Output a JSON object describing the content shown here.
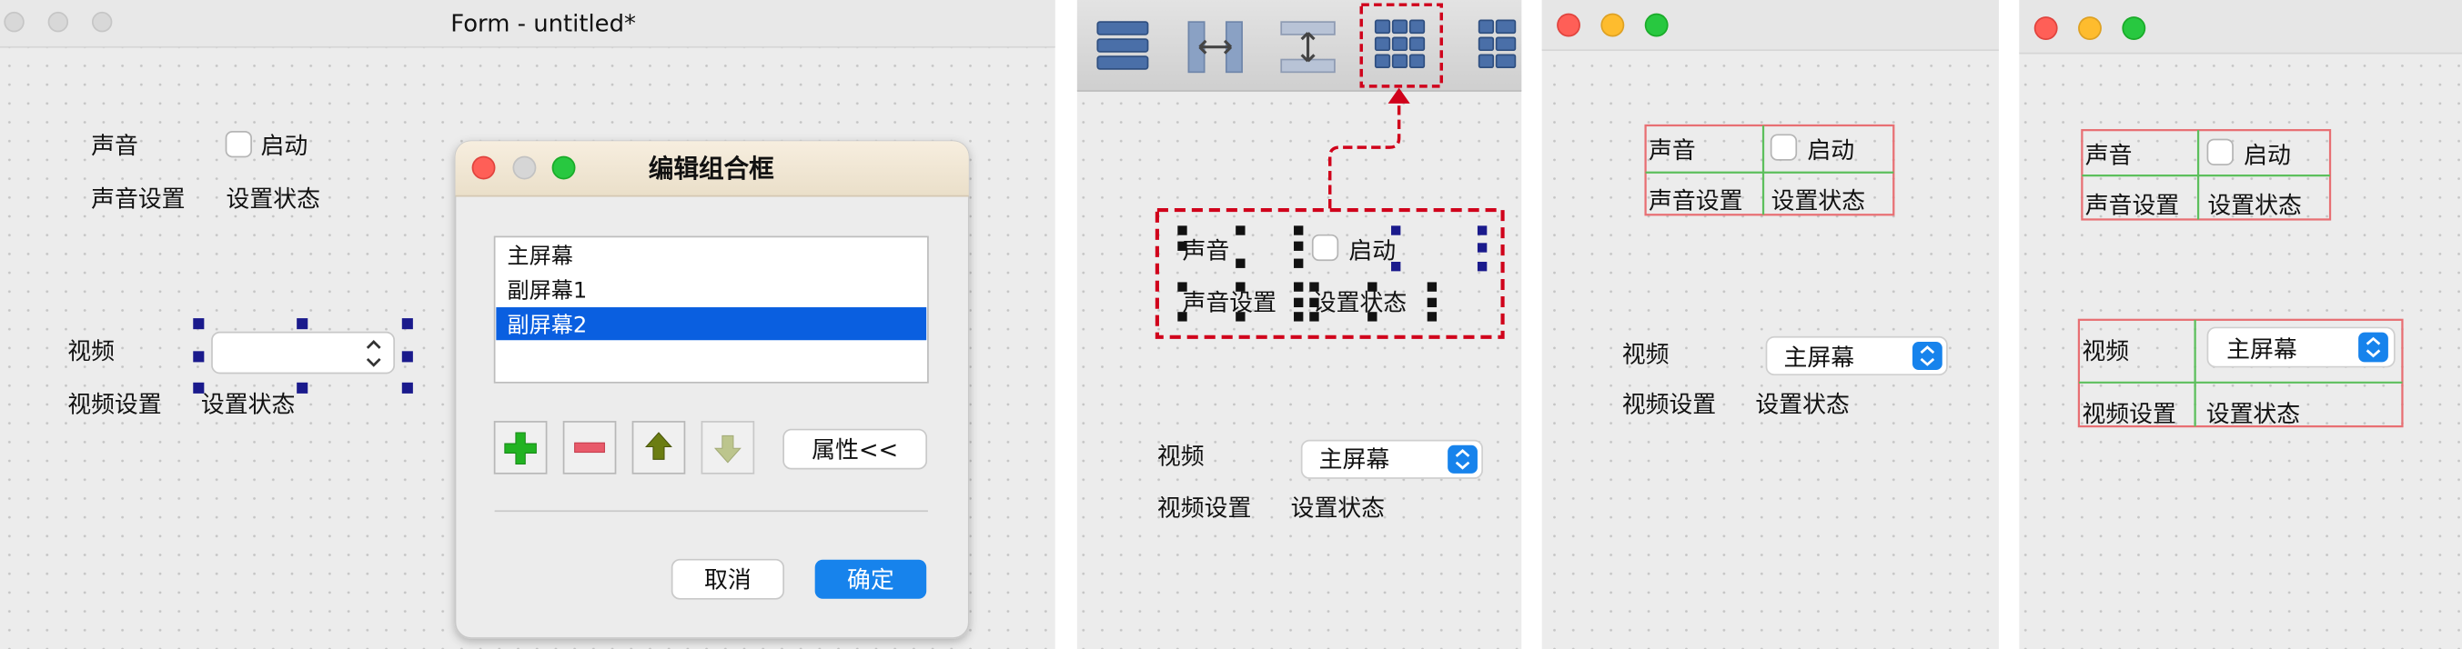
{
  "panel1": {
    "title": "Form - untitled*",
    "sound_label": "声音",
    "enable_label": "启动",
    "sound_settings_label": "声音设置",
    "set_state_label": "设置状态",
    "video_label": "视频",
    "video_settings_label": "视频设置",
    "video_state_label": "设置状态",
    "dialog": {
      "title": "编辑组合框",
      "items": [
        "主屏幕",
        "副屏幕1",
        "副屏幕2"
      ],
      "selected_index": 2,
      "properties_button": "属性<<",
      "cancel_button": "取消",
      "ok_button": "确定"
    }
  },
  "panel2": {
    "sound_label": "声音",
    "enable_label": "启动",
    "sound_settings_label": "声音设置",
    "set_state_label": "设置状态",
    "video_label": "视频",
    "combo_value": "主屏幕",
    "video_settings_label": "视频设置",
    "video_state_label": "设置状态"
  },
  "panel3": {
    "sound_label": "声音",
    "enable_label": "启动",
    "sound_settings_label": "声音设置",
    "set_state_label": "设置状态",
    "video_label": "视频",
    "combo_value": "主屏幕",
    "video_settings_label": "视频设置",
    "video_state_label": "设置状态"
  },
  "panel4": {
    "sound_label": "声音",
    "enable_label": "启动",
    "sound_settings_label": "声音设置",
    "set_state_label": "设置状态",
    "video_label": "视频",
    "combo_value": "主屏幕",
    "video_settings_label": "视频设置",
    "video_state_label": "设置状态"
  },
  "colors": {
    "selection_blue": "#0a5fe0",
    "ok_blue": "#1783ec",
    "mac_red": "#ff5f57",
    "mac_yellow": "#febc2e",
    "mac_green": "#28c840",
    "annotation_red": "#d0021b",
    "layout_red": "#e86f73",
    "layout_green": "#5cbf5c",
    "handle_navy": "#1a1a8c"
  }
}
